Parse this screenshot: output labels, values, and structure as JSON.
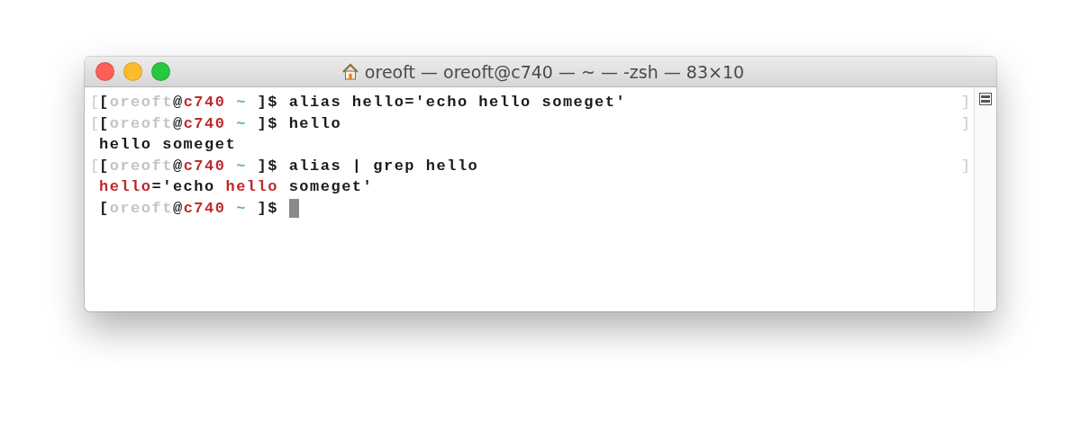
{
  "window": {
    "title": "oreoft — oreoft@c740 — ~ — -zsh — 83×10"
  },
  "lines": [
    {
      "marker_left": "[",
      "marker_right": "]",
      "segments": [
        {
          "kind": "text",
          "text": "["
        },
        {
          "kind": "dim",
          "text": "oreoft"
        },
        {
          "kind": "text",
          "text": "@"
        },
        {
          "kind": "host",
          "text": "c740"
        },
        {
          "kind": "tilde",
          "text": " ~ "
        },
        {
          "kind": "text",
          "text": "]$ alias hello='echo hello someget'"
        }
      ]
    },
    {
      "marker_left": "[",
      "marker_right": "]",
      "segments": [
        {
          "kind": "text",
          "text": "["
        },
        {
          "kind": "dim",
          "text": "oreoft"
        },
        {
          "kind": "text",
          "text": "@"
        },
        {
          "kind": "host",
          "text": "c740"
        },
        {
          "kind": "tilde",
          "text": " ~ "
        },
        {
          "kind": "text",
          "text": "]$ hello"
        }
      ]
    },
    {
      "segments": [
        {
          "kind": "text",
          "text": "hello someget"
        }
      ]
    },
    {
      "marker_left": "[",
      "marker_right": "]",
      "segments": [
        {
          "kind": "text",
          "text": "["
        },
        {
          "kind": "dim",
          "text": "oreoft"
        },
        {
          "kind": "text",
          "text": "@"
        },
        {
          "kind": "host",
          "text": "c740"
        },
        {
          "kind": "tilde",
          "text": " ~ "
        },
        {
          "kind": "text",
          "text": "]$ alias | grep hello"
        }
      ]
    },
    {
      "segments": [
        {
          "kind": "host",
          "text": "hello"
        },
        {
          "kind": "text",
          "text": "='echo "
        },
        {
          "kind": "host",
          "text": "hello"
        },
        {
          "kind": "text",
          "text": " someget'"
        }
      ]
    },
    {
      "cursor": true,
      "segments": [
        {
          "kind": "text",
          "text": "["
        },
        {
          "kind": "dim",
          "text": "oreoft"
        },
        {
          "kind": "text",
          "text": "@"
        },
        {
          "kind": "host",
          "text": "c740"
        },
        {
          "kind": "tilde",
          "text": " ~ "
        },
        {
          "kind": "text",
          "text": "]$ "
        }
      ]
    }
  ]
}
